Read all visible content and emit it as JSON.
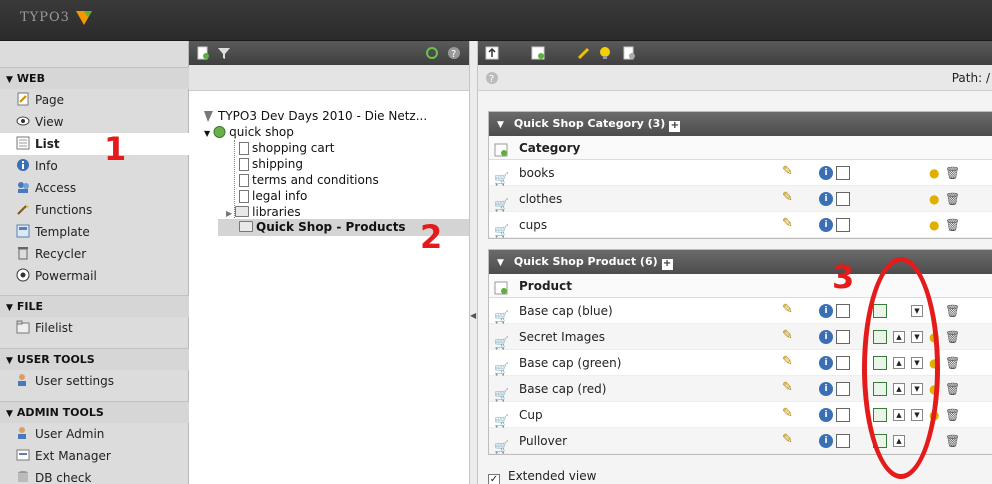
{
  "app": {
    "logo_text": "TYPO3"
  },
  "modules": [
    {
      "section": "WEB",
      "items": [
        {
          "label": "Page",
          "icon": "page-icon"
        },
        {
          "label": "View",
          "icon": "eye-icon"
        },
        {
          "label": "List",
          "icon": "list-icon",
          "selected": true
        },
        {
          "label": "Info",
          "icon": "info-icon"
        },
        {
          "label": "Access",
          "icon": "access-icon"
        },
        {
          "label": "Functions",
          "icon": "wand-icon"
        },
        {
          "label": "Template",
          "icon": "template-icon"
        },
        {
          "label": "Recycler",
          "icon": "recycler-icon"
        },
        {
          "label": "Powermail",
          "icon": "powermail-icon"
        }
      ]
    },
    {
      "section": "FILE",
      "items": [
        {
          "label": "Filelist",
          "icon": "filelist-icon"
        }
      ]
    },
    {
      "section": "USER TOOLS",
      "items": [
        {
          "label": "User settings",
          "icon": "user-settings-icon"
        }
      ]
    },
    {
      "section": "ADMIN TOOLS",
      "items": [
        {
          "label": "User Admin",
          "icon": "user-admin-icon"
        },
        {
          "label": "Ext Manager",
          "icon": "ext-manager-icon"
        },
        {
          "label": "DB check",
          "icon": "db-check-icon"
        }
      ]
    }
  ],
  "tree": {
    "root": "TYPO3 Dev Days 2010 - Die Netz...",
    "site": "quick shop",
    "children": [
      "shopping cart",
      "shipping",
      "terms and conditions",
      "legal info",
      "libraries",
      "Quick Shop - Products"
    ]
  },
  "content": {
    "path_label": "Path: /",
    "extended_view_label": "Extended view",
    "extended_view_checked": true,
    "tables": [
      {
        "title": "Quick Shop Category (3)",
        "column": "Category",
        "rows": [
          "books",
          "clothes",
          "cups"
        ]
      },
      {
        "title": "Quick Shop Product (6)",
        "column": "Product",
        "rows": [
          "Base cap (blue)",
          "Secret Images",
          "Base cap (green)",
          "Base cap (red)",
          "Cup",
          "Pullover"
        ]
      }
    ]
  },
  "annotations": {
    "one": "1",
    "two": "2",
    "three": "3",
    "color": "#e41b1b"
  }
}
